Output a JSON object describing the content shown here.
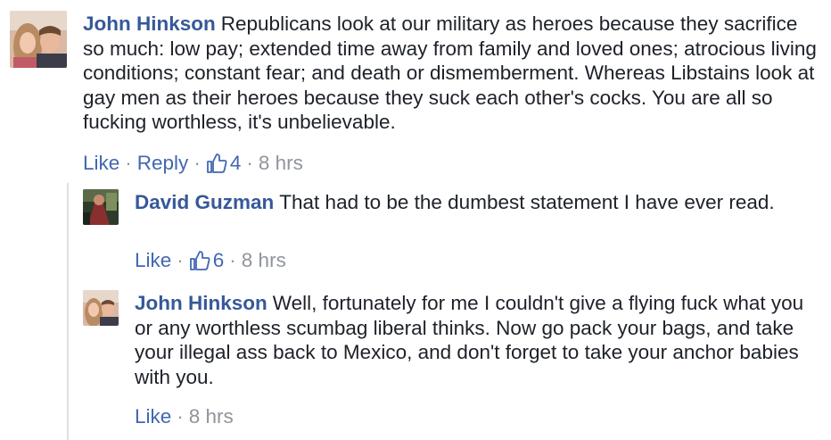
{
  "comments": [
    {
      "author": "John Hinkson",
      "text": "Republicans look at our military as heroes because they sacrifice so much: low pay; extended time away from family and loved ones; atrocious living conditions; constant fear; and death or dismemberment. Whereas Libstains look at gay men as their heroes because they suck each other's cocks. You are all so fucking worthless, it's unbelievable.",
      "like_label": "Like",
      "reply_label": "Reply",
      "like_count": "4",
      "time": "8 hrs"
    }
  ],
  "replies": [
    {
      "author": "David Guzman",
      "text": "That had to be the dumbest statement I have ever read.",
      "like_label": "Like",
      "like_count": "6",
      "time": "8 hrs"
    },
    {
      "author": "John Hinkson",
      "text": "Well, fortunately for me I couldn't give a flying fuck what you or any worthless scumbag liberal thinks. Now go pack your bags, and take your illegal ass back to Mexico, and don't forget to take your anchor babies with you.",
      "like_label": "Like",
      "time": "8 hrs"
    }
  ],
  "separator": "·",
  "colors": {
    "author": "#365899",
    "link": "#4267b2",
    "meta": "#90949c",
    "text": "#1d2129"
  },
  "icons": [
    "thumbs-up-icon"
  ]
}
